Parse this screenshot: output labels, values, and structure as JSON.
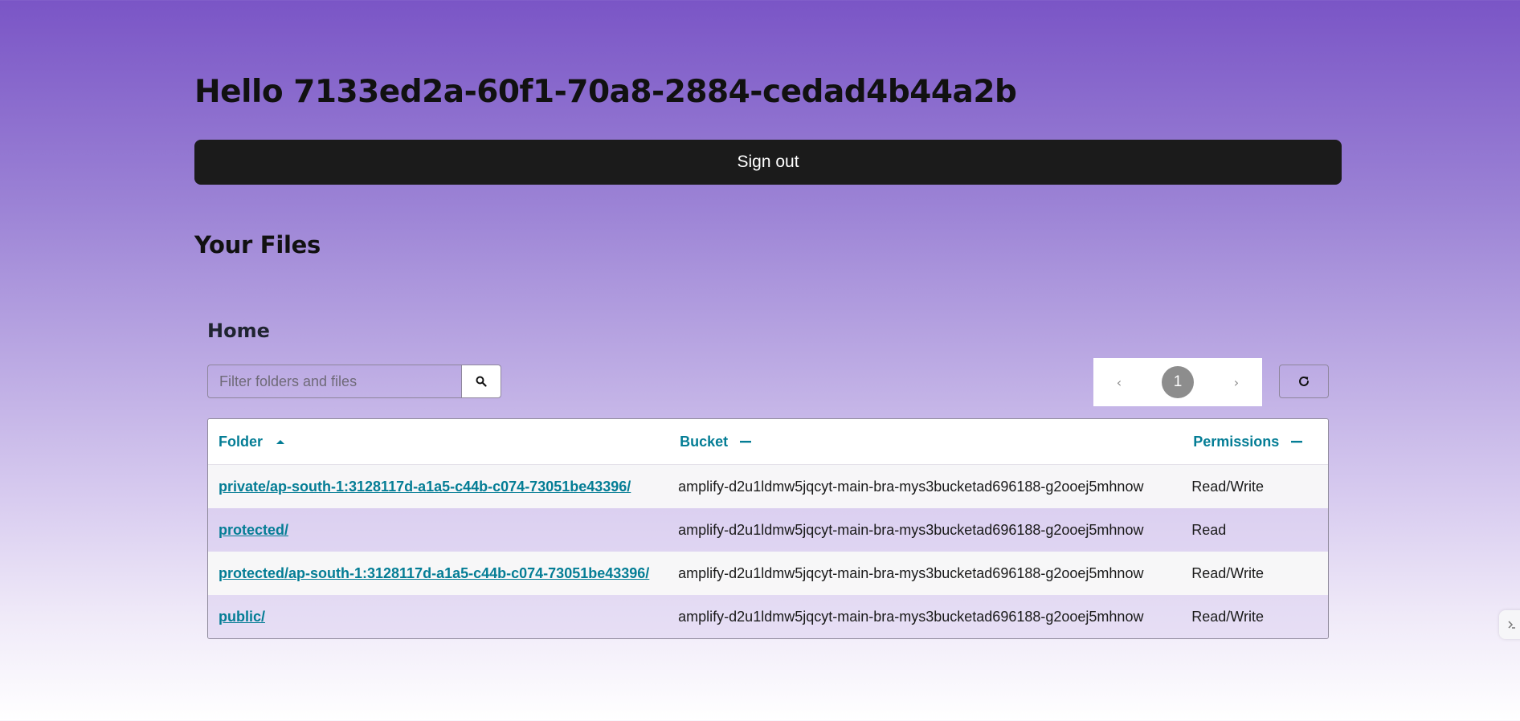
{
  "greeting": "Hello 7133ed2a-60f1-70a8-2884-cedad4b44a2b",
  "signout_label": "Sign out",
  "files_title": "Your Files",
  "storage_browser": {
    "location_title": "Home",
    "search": {
      "placeholder": "Filter folders and files",
      "value": ""
    },
    "pagination": {
      "prev": "‹",
      "current_page": "1",
      "next": "›"
    },
    "table": {
      "columns": [
        {
          "label": "Folder",
          "sort": "ascending"
        },
        {
          "label": "Bucket",
          "sort": "none"
        },
        {
          "label": "Permissions",
          "sort": "none"
        }
      ],
      "rows": [
        {
          "folder": "private/ap-south-1:3128117d-a1a5-c44b-c074-73051be43396/",
          "bucket": "amplify-d2u1ldmw5jqcyt-main-bra-mys3bucketad696188-g2ooej5mhnow",
          "permissions": "Read/Write"
        },
        {
          "folder": "protected/",
          "bucket": "amplify-d2u1ldmw5jqcyt-main-bra-mys3bucketad696188-g2ooej5mhnow",
          "permissions": "Read"
        },
        {
          "folder": "protected/ap-south-1:3128117d-a1a5-c44b-c074-73051be43396/",
          "bucket": "amplify-d2u1ldmw5jqcyt-main-bra-mys3bucketad696188-g2ooej5mhnow",
          "permissions": "Read/Write"
        },
        {
          "folder": "public/",
          "bucket": "amplify-d2u1ldmw5jqcyt-main-bra-mys3bucketad696188-g2ooej5mhnow",
          "permissions": "Read/Write"
        }
      ]
    }
  },
  "icons": {
    "search": "search-icon",
    "refresh": "refresh-icon",
    "sort_ascending": "sort-ascending-icon",
    "sort_none": "sort-none-icon",
    "side_tab": "chevron-right-icon"
  },
  "colors": {
    "accent": "#047d95",
    "signout_bg": "#1b1b1b",
    "gradient_top": "#7a55c6",
    "page_active": "#8d8d8d"
  }
}
